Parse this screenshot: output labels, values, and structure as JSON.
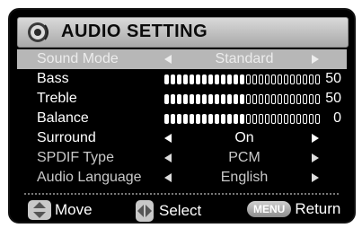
{
  "header": {
    "title": "AUDIO SETTING",
    "icon": "speaker-icon"
  },
  "menu": {
    "sound_mode": {
      "label": "Sound Mode",
      "value": "Standard",
      "selected": true
    },
    "bass": {
      "label": "Bass",
      "level": 50,
      "max": 100,
      "value_text": "50"
    },
    "treble": {
      "label": "Treble",
      "level": 50,
      "max": 100,
      "value_text": "50"
    },
    "balance": {
      "label": "Balance",
      "level": 50,
      "max": 100,
      "value_text": "0"
    },
    "surround": {
      "label": "Surround",
      "value": "On"
    },
    "spdif": {
      "label": "SPDIF Type",
      "value": "PCM"
    },
    "audio_language": {
      "label": "Audio Language",
      "value": "English"
    }
  },
  "footer": {
    "move": {
      "label": "Move",
      "icon": "up-down-icon"
    },
    "select": {
      "label": "Select",
      "icon": "left-right-icon"
    },
    "return": {
      "key": "MENU",
      "label": "Return"
    }
  },
  "colors": {
    "background": "#000000",
    "header": "#c0c0c0",
    "selected_row": "#b7b7b7",
    "text": "#ffffff"
  }
}
